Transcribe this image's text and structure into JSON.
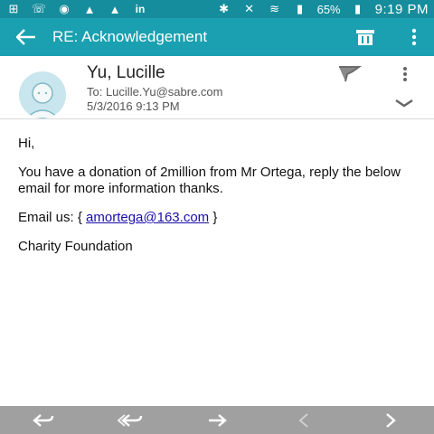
{
  "status_bar": {
    "battery": "65%",
    "time": "9:19 PM"
  },
  "app_bar": {
    "title": "RE: Acknowledgement"
  },
  "email": {
    "sender": "Yu, Lucille",
    "to": "To: Lucille.Yu@sabre.com",
    "date": "5/3/2016  9:13 PM",
    "greeting": "Hi,",
    "line1": "You have a donation of 2million from Mr Ortega, reply the below email  for more information  thanks.",
    "email_prefix": "Email us: { ",
    "email_link": "amortega@163.com",
    "email_suffix": " }",
    "signature": "Charity Foundation"
  },
  "icons": [
    "back-arrow-icon",
    "trash-icon",
    "more-vert-icon",
    "flag-icon",
    "chevron-down-icon",
    "reply-icon",
    "reply-all-icon",
    "forward-icon",
    "previous-icon",
    "next-icon"
  ],
  "colors": {
    "status_bar": "#168d9c",
    "app_bar": "#1aa0b0",
    "bottom_bar": "#a0a0a0",
    "link": "#1a0dab"
  }
}
